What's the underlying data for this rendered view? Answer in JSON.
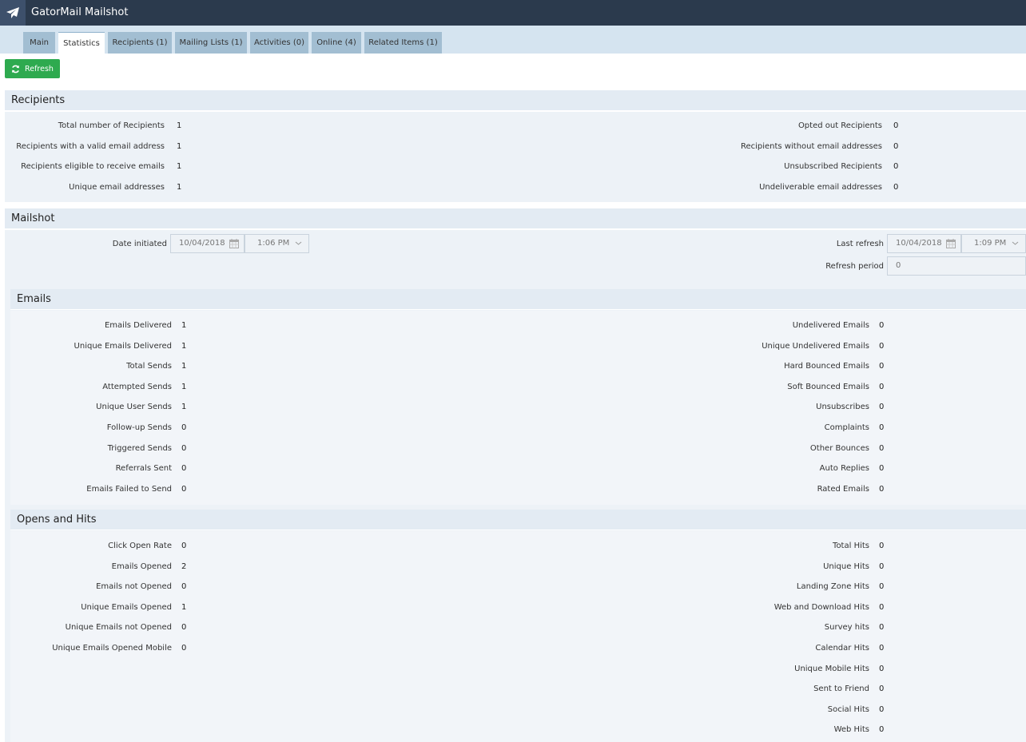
{
  "app": {
    "title": "GatorMail Mailshot"
  },
  "tabs": [
    {
      "label": "Main"
    },
    {
      "label": "Statistics"
    },
    {
      "label": "Recipients (1)"
    },
    {
      "label": "Mailing Lists (1)"
    },
    {
      "label": "Activities (0)"
    },
    {
      "label": "Online (4)"
    },
    {
      "label": "Related Items (1)"
    }
  ],
  "toolbar": {
    "refresh_label": "Refresh"
  },
  "recipients": {
    "title": "Recipients",
    "left": [
      {
        "label": "Total number of Recipients",
        "value": "1"
      },
      {
        "label": "Recipients with a valid email address",
        "value": "1"
      },
      {
        "label": "Recipients eligible to receive emails",
        "value": "1"
      },
      {
        "label": "Unique email addresses",
        "value": "1"
      }
    ],
    "right": [
      {
        "label": "Opted out Recipients",
        "value": "0"
      },
      {
        "label": "Recipients without email addresses",
        "value": "0"
      },
      {
        "label": "Unsubscribed Recipients",
        "value": "0"
      },
      {
        "label": "Undeliverable email addresses",
        "value": "0"
      }
    ]
  },
  "mailshot": {
    "title": "Mailshot",
    "date_initiated_label": "Date initiated",
    "date_initiated_date": "10/04/2018",
    "date_initiated_time": "1:06 PM",
    "last_refresh_label": "Last refresh",
    "last_refresh_date": "10/04/2018",
    "last_refresh_time": "1:09 PM",
    "refresh_period_label": "Refresh period",
    "refresh_period_value": "0"
  },
  "emails": {
    "title": "Emails",
    "left": [
      {
        "label": "Emails Delivered",
        "value": "1"
      },
      {
        "label": "Unique Emails Delivered",
        "value": "1"
      },
      {
        "label": "Total Sends",
        "value": "1"
      },
      {
        "label": "Attempted Sends",
        "value": "1"
      },
      {
        "label": "Unique User Sends",
        "value": "1"
      },
      {
        "label": "Follow-up Sends",
        "value": "0"
      },
      {
        "label": "Triggered Sends",
        "value": "0"
      },
      {
        "label": "Referrals Sent",
        "value": "0"
      },
      {
        "label": "Emails Failed to Send",
        "value": "0"
      }
    ],
    "right": [
      {
        "label": "Undelivered Emails",
        "value": "0"
      },
      {
        "label": "Unique Undelivered Emails",
        "value": "0"
      },
      {
        "label": "Hard Bounced Emails",
        "value": "0"
      },
      {
        "label": "Soft Bounced Emails",
        "value": "0"
      },
      {
        "label": "Unsubscribes",
        "value": "0"
      },
      {
        "label": "Complaints",
        "value": "0"
      },
      {
        "label": "Other Bounces",
        "value": "0"
      },
      {
        "label": "Auto Replies",
        "value": "0"
      },
      {
        "label": "Rated Emails",
        "value": "0"
      }
    ]
  },
  "opens": {
    "title": "Opens and Hits",
    "left": [
      {
        "label": "Click Open Rate",
        "value": "0"
      },
      {
        "label": "Emails Opened",
        "value": "2"
      },
      {
        "label": "Emails not Opened",
        "value": "0"
      },
      {
        "label": "Unique Emails Opened",
        "value": "1"
      },
      {
        "label": "Unique Emails not Opened",
        "value": "0"
      },
      {
        "label": "Unique Emails Opened Mobile",
        "value": "0"
      }
    ],
    "right": [
      {
        "label": "Total Hits",
        "value": "0"
      },
      {
        "label": "Unique Hits",
        "value": "0"
      },
      {
        "label": "Landing Zone Hits",
        "value": "0"
      },
      {
        "label": "Web and Download Hits",
        "value": "0"
      },
      {
        "label": "Survey hits",
        "value": "0"
      },
      {
        "label": "Calendar Hits",
        "value": "0"
      },
      {
        "label": "Unique Mobile Hits",
        "value": "0"
      },
      {
        "label": "Sent to Friend",
        "value": "0"
      },
      {
        "label": "Social Hits",
        "value": "0"
      },
      {
        "label": "Web Hits",
        "value": "0"
      }
    ]
  }
}
